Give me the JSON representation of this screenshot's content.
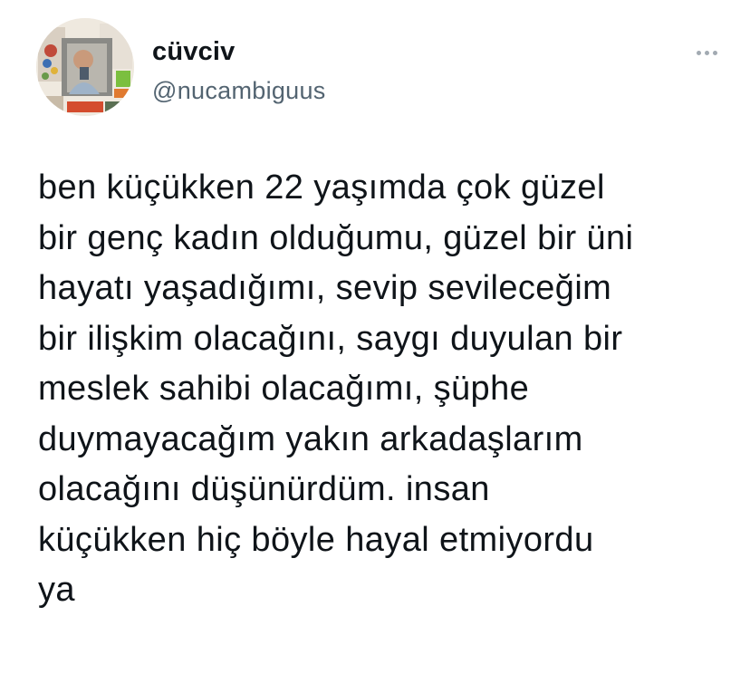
{
  "tweet": {
    "author": {
      "display_name": "cüvciv",
      "handle": "@nucambiguus",
      "avatar_icon": "profile-photo"
    },
    "more_icon": "more-horizontal-icon",
    "text_lines": [
      "ben küçükken 22 yaşımda çok güzel",
      "bir genç kadın olduğumu, güzel bir üni",
      "hayatı yaşadığımı, sevip sevileceğim",
      "bir ilişkim olacağını, saygı duyulan bir",
      "meslek sahibi olacağımı, şüphe",
      "duymayacağım yakın arkadaşlarım",
      "olacağını düşünürdüm. insan",
      "küçükken hiç böyle hayal etmiyordu",
      "ya"
    ]
  }
}
